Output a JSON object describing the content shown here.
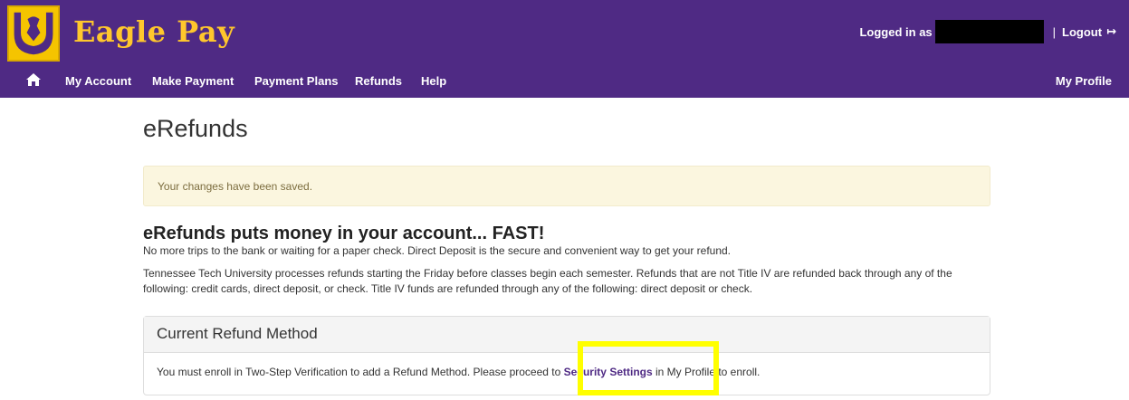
{
  "header": {
    "app_title": "Eagle Pay",
    "logged_in_label": "Logged in as",
    "logout_label": "Logout",
    "bg_color": "#4f2a84",
    "title_color": "#ffc72c"
  },
  "nav": {
    "items": [
      {
        "label": "My Account"
      },
      {
        "label": "Make Payment"
      },
      {
        "label": "Payment Plans"
      },
      {
        "label": "Refunds"
      },
      {
        "label": "Help"
      }
    ],
    "profile_label": "My Profile"
  },
  "main": {
    "page_title": "eRefunds",
    "alert_text": "Your changes have been saved.",
    "headline": "eRefunds puts money in your account... FAST!",
    "para1": "No more trips to the bank or waiting for a paper check. Direct Deposit is the secure and convenient way to get your refund.",
    "para2": "Tennessee Tech University processes refunds starting the Friday before classes begin each semester. Refunds that are not Title IV are refunded back through any of the following: credit cards, direct deposit, or check. Title IV funds are refunded through any of the following: direct deposit or check."
  },
  "panel": {
    "heading": "Current Refund Method",
    "message_before": "You must enroll in Two-Step Verification to add a Refund Method. Please proceed to ",
    "link_label": "Security Settings",
    "message_after": " in My Profile to enroll."
  }
}
